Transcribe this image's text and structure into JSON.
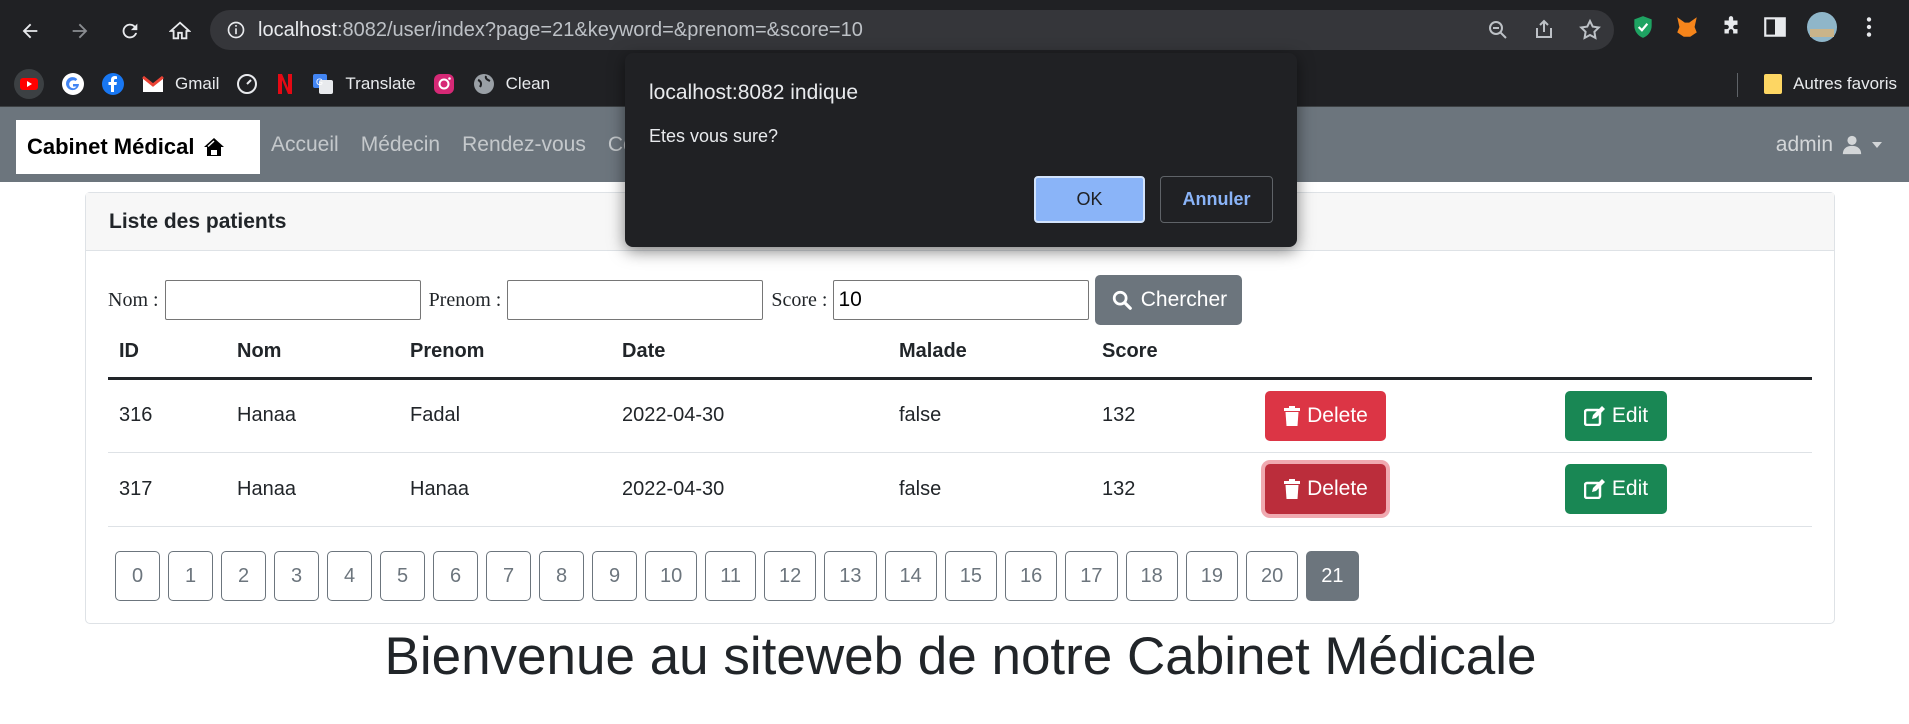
{
  "browser": {
    "url_host": "localhost",
    "url_rest": ":8082/user/index?page=21&keyword=&prenom=&score=10",
    "bookmarks": [
      "Gmail",
      "Translate",
      "Clean"
    ],
    "other_bookmarks": "Autres favoris"
  },
  "navbar": {
    "brand": "Cabinet Médical",
    "links": [
      "Accueil",
      "Médecin",
      "Rendez-vous",
      "Co"
    ],
    "user": "admin"
  },
  "card": {
    "title": "Liste des patients",
    "search": {
      "nom_label": "Nom :",
      "prenom_label": "Prenom :",
      "score_label": "Score :",
      "nom_value": "",
      "prenom_value": "",
      "score_value": "10",
      "button": "Chercher"
    },
    "columns": [
      "ID",
      "Nom",
      "Prenom",
      "Date",
      "Malade",
      "Score"
    ],
    "rows": [
      {
        "id": "316",
        "nom": "Hanaa",
        "prenom": "Fadal",
        "date": "2022-04-30",
        "malade": "false",
        "score": "132"
      },
      {
        "id": "317",
        "nom": "Hanaa",
        "prenom": "Hanaa",
        "date": "2022-04-30",
        "malade": "false",
        "score": "132"
      }
    ],
    "delete_label": "Delete",
    "edit_label": "Edit",
    "pages": [
      "0",
      "1",
      "2",
      "3",
      "4",
      "5",
      "6",
      "7",
      "8",
      "9",
      "10",
      "11",
      "12",
      "13",
      "14",
      "15",
      "16",
      "17",
      "18",
      "19",
      "20",
      "21"
    ],
    "current_page": "21"
  },
  "welcome": "Bienvenue au siteweb de notre Cabinet Médicale",
  "dialog": {
    "title": "localhost:8082 indique",
    "message": "Etes vous sure?",
    "ok": "OK",
    "cancel": "Annuler"
  },
  "colors": {
    "navbar": "#6c757d",
    "delete": "#dc3545",
    "edit": "#198754",
    "dialog_ok": "#8ab4f8"
  }
}
